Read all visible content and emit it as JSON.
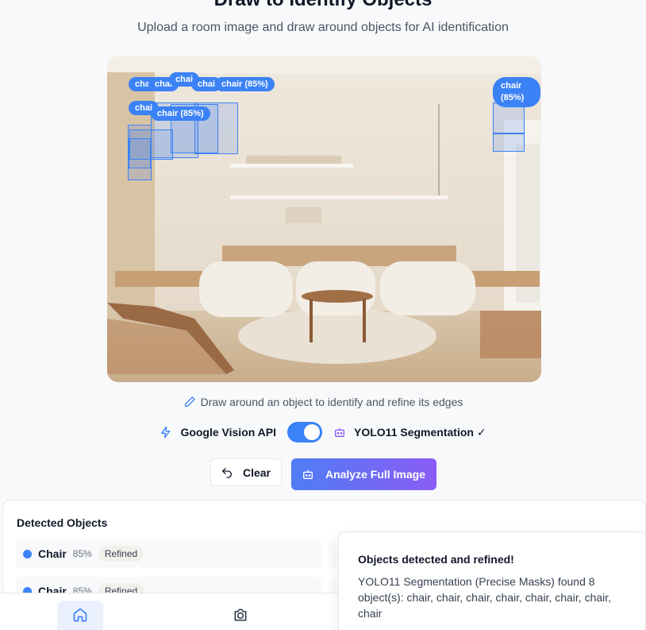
{
  "header": {
    "title": "Draw to Identify Objects",
    "subtitle": "Upload a room image and draw around objects for AI identification"
  },
  "image": {
    "labels": [
      "chai",
      "chai",
      "chai",
      "chai",
      "chair (85%)",
      "chair (85%)",
      "chai",
      "chair (85%)"
    ]
  },
  "hint": "Draw around an object to identify and refine its edges",
  "toggle": {
    "left_label": "Google Vision API",
    "right_label": "YOLO11 Segmentation ✓",
    "enabled": true
  },
  "buttons": {
    "clear": "Clear",
    "analyze": "Analyze Full Image"
  },
  "detected": {
    "title": "Detected Objects",
    "items": [
      {
        "name": "Chair",
        "confidence": "85%",
        "status": "Refined"
      },
      {
        "name": "Chair",
        "confidence": "85%",
        "status": "Refined"
      }
    ]
  },
  "toast": {
    "title": "Objects detected and refined!",
    "message": "YOLO11 Segmentation (Precise Masks) found 8 object(s): chair, chair, chair, chair, chair, chair, chair, chair"
  },
  "colors": {
    "accent": "#3b82f6",
    "gradient_end": "#8b5cf6"
  }
}
